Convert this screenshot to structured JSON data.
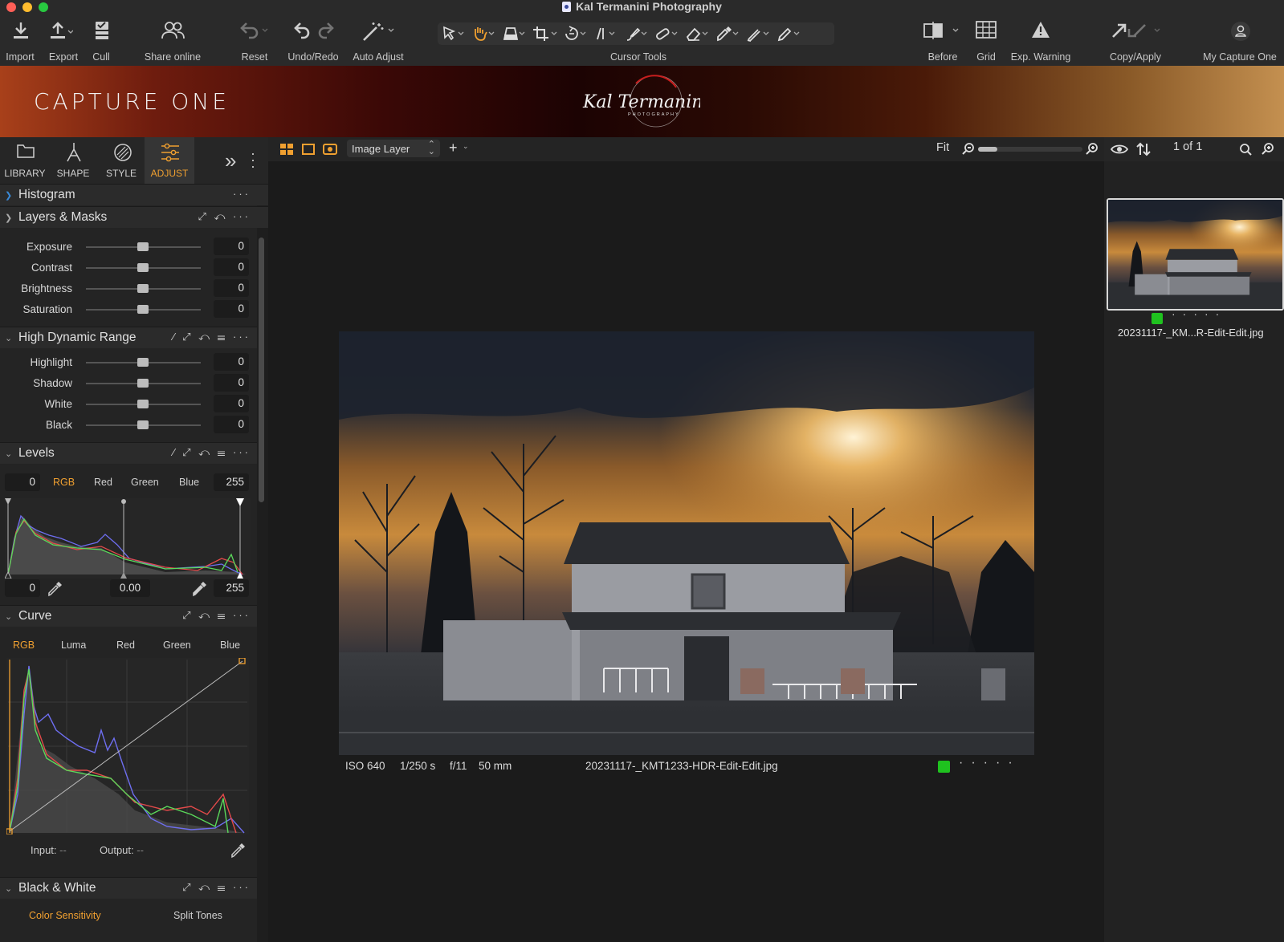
{
  "window": {
    "title": "Kal Termanini Photography"
  },
  "toolbar": {
    "import": "Import",
    "export": "Export",
    "cull": "Cull",
    "share_online": "Share online",
    "reset": "Reset",
    "undo_redo": "Undo/Redo",
    "auto_adjust": "Auto Adjust",
    "cursor_tools": "Cursor Tools",
    "before": "Before",
    "grid": "Grid",
    "exp_warning": "Exp. Warning",
    "copy_apply": "Copy/Apply",
    "my_capture_one": "My Capture One"
  },
  "banner": {
    "brand": "CAPTURE ONE",
    "logo_text": "Kal Termanini",
    "logo_sub": "PHOTOGRAPHY",
    "logo_ring": "CURVES / SHADOWS / LIGHT / CURVES / SHADOWS / LIGHT / CURVES / SHADOWS /"
  },
  "tool_tabs": [
    {
      "label": "LIBRARY",
      "icon": "folder-icon"
    },
    {
      "label": "SHAPE",
      "icon": "shape-icon"
    },
    {
      "label": "STYLE",
      "icon": "style-icon"
    },
    {
      "label": "ADJUST",
      "icon": "adjust-icon",
      "active": true
    }
  ],
  "sections": {
    "histogram": "Histogram",
    "layers_masks": "Layers & Masks",
    "hdr": "High Dynamic Range",
    "levels": "Levels",
    "curve": "Curve",
    "bw": "Black & White"
  },
  "basic_sliders": [
    {
      "label": "Exposure",
      "value": "0"
    },
    {
      "label": "Contrast",
      "value": "0"
    },
    {
      "label": "Brightness",
      "value": "0"
    },
    {
      "label": "Saturation",
      "value": "0"
    }
  ],
  "hdr_sliders": [
    {
      "label": "Highlight",
      "value": "0"
    },
    {
      "label": "Shadow",
      "value": "0"
    },
    {
      "label": "White",
      "value": "0"
    },
    {
      "label": "Black",
      "value": "0"
    }
  ],
  "levels": {
    "low": "0",
    "high": "255",
    "channels": [
      "RGB",
      "Red",
      "Green",
      "Blue"
    ],
    "active_channel": "RGB",
    "out_low": "0",
    "mid": "0.00",
    "out_high": "255"
  },
  "curve": {
    "channels": [
      "RGB",
      "Luma",
      "Red",
      "Green",
      "Blue"
    ],
    "active_channel": "RGB",
    "input_label": "Input:",
    "input_value": "--",
    "output_label": "Output:",
    "output_value": "--"
  },
  "bw": {
    "tab1": "Color Sensitivity",
    "tab2": "Split Tones"
  },
  "viewer": {
    "layer": "Image Layer",
    "zoom": "Fit",
    "zoom_level": 0.1,
    "iso": "ISO 640",
    "shutter": "1/250 s",
    "aperture": "f/11",
    "focal": "50 mm",
    "filename": "20231117-_KMT1233-HDR-Edit-Edit.jpg",
    "color_tag": "#1fc21f"
  },
  "browser": {
    "count": "1 of 1",
    "thumb_name": "20231117-_KM...R-Edit-Edit.jpg",
    "color_tag": "#1fc21f"
  },
  "colors": {
    "accent": "#f0a030",
    "tag_green": "#1fc21f"
  }
}
